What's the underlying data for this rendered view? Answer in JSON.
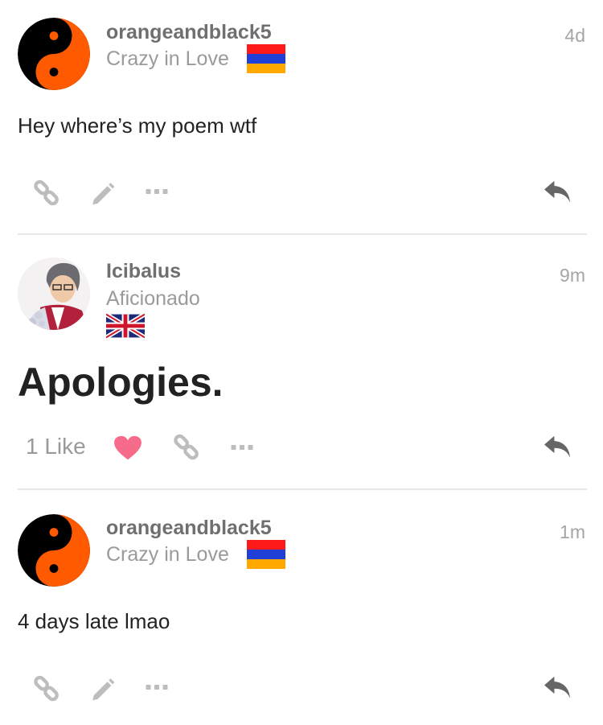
{
  "posts": [
    {
      "username": "orangeandblack5",
      "user_title": "Crazy in Love",
      "flag": "armenia-flag",
      "time": "4d",
      "body": "Hey where’s my poem wtf",
      "actions": [
        "link-icon",
        "edit-icon",
        "more-icon",
        "reply-icon"
      ]
    },
    {
      "username": "Icibalus",
      "user_title": "Aficionado",
      "flag": "uk-flag",
      "time": "9m",
      "body": "Apologies.",
      "like_count": "1 Like",
      "actions": [
        "heart-icon",
        "link-icon",
        "more-icon",
        "reply-icon"
      ]
    },
    {
      "username": "orangeandblack5",
      "user_title": "Crazy in Love",
      "flag": "armenia-flag",
      "time": "1m",
      "body": "4 days late lmao",
      "actions": [
        "link-icon",
        "edit-icon",
        "more-icon",
        "reply-icon"
      ]
    }
  ],
  "colors": {
    "avatar_orange": "#ff5a00",
    "heart": "#f76b8a",
    "icon_gray": "#bdbdbd",
    "reply_gray": "#666666"
  }
}
